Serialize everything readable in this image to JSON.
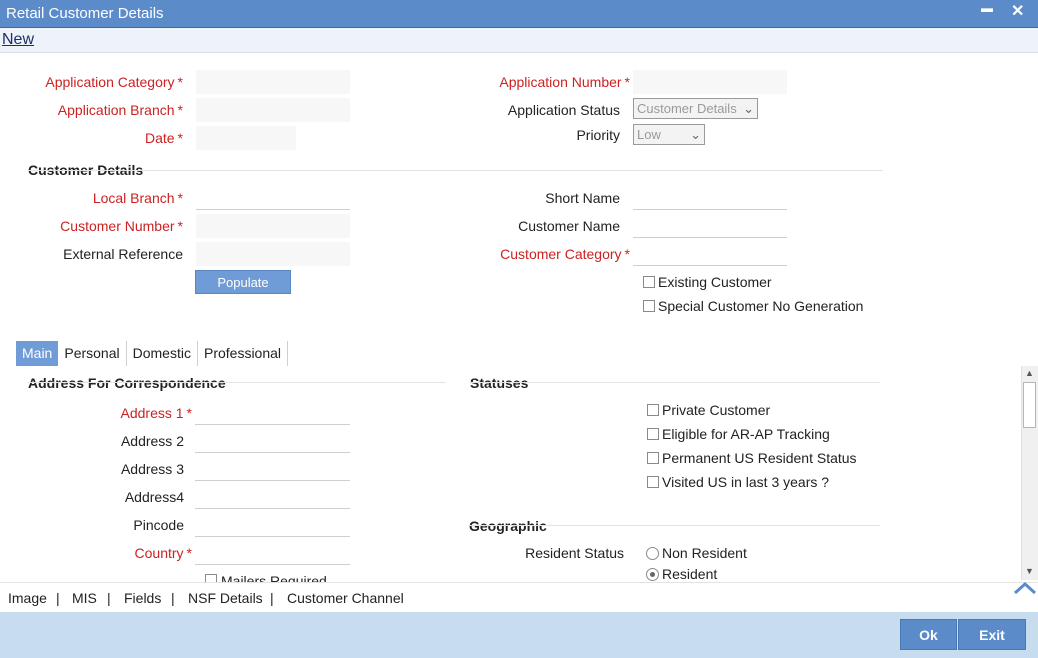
{
  "window": {
    "title": "Retail Customer Details",
    "minimize_glyph": "▬",
    "close_glyph": "✕"
  },
  "toolbar": {
    "new_label": "New"
  },
  "header": {
    "application_category": {
      "label": "Application Category",
      "value": ""
    },
    "application_branch": {
      "label": "Application Branch",
      "value": ""
    },
    "date": {
      "label": "Date",
      "value": ""
    },
    "application_number": {
      "label": "Application Number",
      "value": ""
    },
    "application_status": {
      "label": "Application Status",
      "value": "Customer Details"
    },
    "priority": {
      "label": "Priority",
      "value": "Low"
    },
    "required_marker": "*"
  },
  "customer_details": {
    "section_title": "Customer Details",
    "local_branch": {
      "label": "Local Branch",
      "value": ""
    },
    "customer_number": {
      "label": "Customer Number",
      "value": ""
    },
    "external_reference": {
      "label": "External Reference",
      "value": ""
    },
    "short_name": {
      "label": "Short Name",
      "value": ""
    },
    "customer_name": {
      "label": "Customer Name",
      "value": ""
    },
    "customer_category": {
      "label": "Customer Category",
      "value": ""
    },
    "populate_label": "Populate",
    "existing_customer": {
      "label": "Existing Customer",
      "checked": false
    },
    "special_customer_no": {
      "label": "Special Customer No Generation",
      "checked": false
    }
  },
  "tabs": [
    "Main",
    "Personal",
    "Domestic",
    "Professional"
  ],
  "active_tab": 0,
  "address": {
    "section_title": "Address For Correspondence",
    "address1": {
      "label": "Address 1",
      "value": ""
    },
    "address2": {
      "label": "Address 2",
      "value": ""
    },
    "address3": {
      "label": "Address 3",
      "value": ""
    },
    "address4": {
      "label": "Address4",
      "value": ""
    },
    "pincode": {
      "label": "Pincode",
      "value": ""
    },
    "country": {
      "label": "Country",
      "value": ""
    },
    "mailers_required": {
      "label": "Mailers Required",
      "checked": false
    }
  },
  "statuses": {
    "section_title": "Statuses",
    "private_customer": {
      "label": "Private Customer",
      "checked": false
    },
    "ar_ap_tracking": {
      "label": "Eligible for AR-AP Tracking",
      "checked": false
    },
    "permanent_us_resident": {
      "label": "Permanent US Resident Status",
      "checked": false
    },
    "visited_us": {
      "label": "Visited US in last 3 years ?",
      "checked": false
    }
  },
  "geographic": {
    "section_title": "Geographic",
    "resident_status_label": "Resident Status",
    "options": [
      "Non Resident",
      "Resident"
    ],
    "selected": "Resident"
  },
  "footer": {
    "links": [
      "Image",
      "MIS",
      "Fields",
      "NSF Details",
      "Customer Channel"
    ],
    "separator": "|",
    "ok_label": "Ok",
    "exit_label": "Exit"
  },
  "colors": {
    "title_bar": "#5b8bc9",
    "required_label": "#cc2222",
    "active_tab": "#6f9bd6",
    "bottom_bar": "#c8dcef"
  }
}
